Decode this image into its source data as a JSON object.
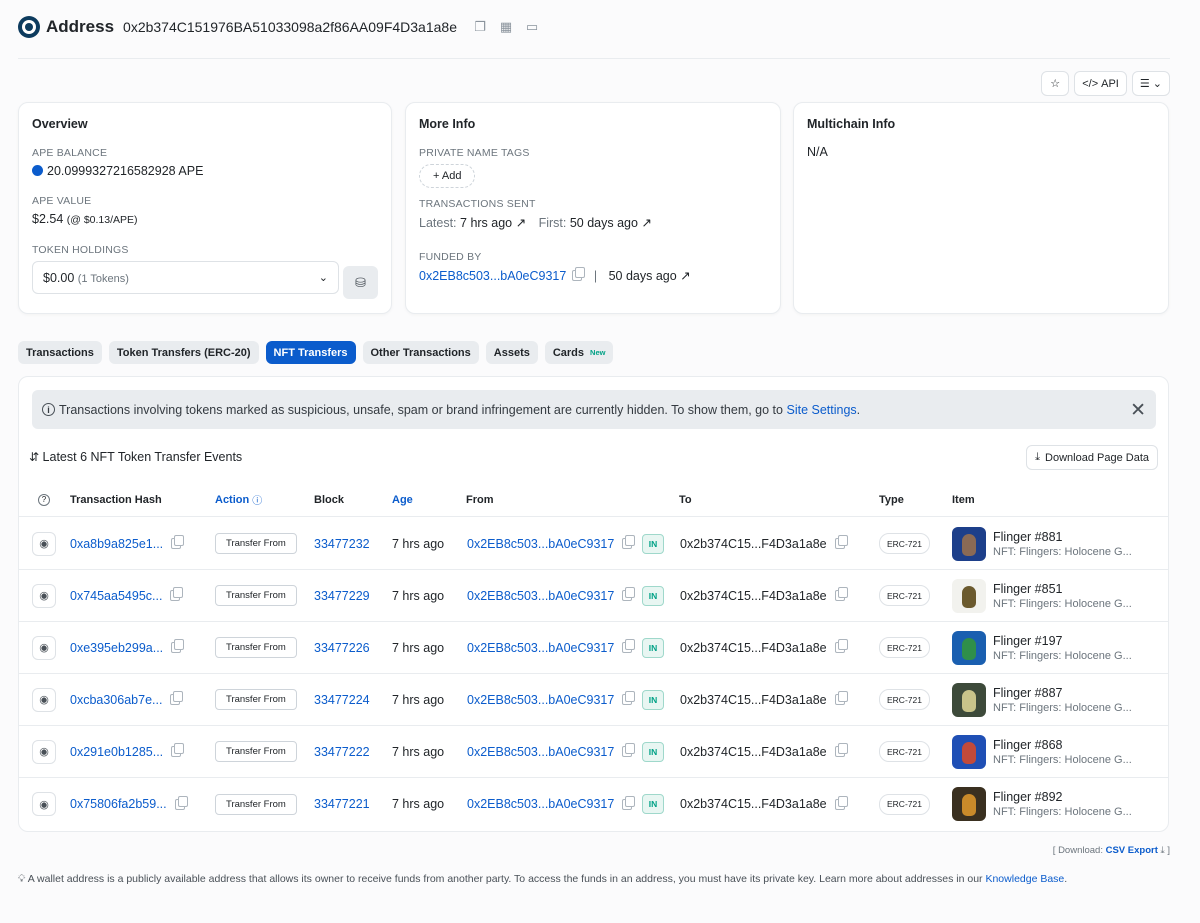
{
  "header": {
    "title": "Address",
    "address": "0x2b374C151976BA51033098a2f86AA09F4D3a1a8e"
  },
  "toolbar": {
    "api_label": "API"
  },
  "overview": {
    "title": "Overview",
    "balance_label": "APE BALANCE",
    "balance_value": "20.0999327216582928 APE",
    "value_label": "APE VALUE",
    "value_amount": "$2.54",
    "value_rate": "(@ $0.13/APE)",
    "holdings_label": "TOKEN HOLDINGS",
    "holdings_value": "$0.00",
    "holdings_count": "(1 Tokens)"
  },
  "more_info": {
    "title": "More Info",
    "tags_label": "PRIVATE NAME TAGS",
    "add_label": "+ Add",
    "tx_sent_label": "TRANSACTIONS SENT",
    "latest_label": "Latest:",
    "latest_value": "7 hrs ago",
    "first_label": "First:",
    "first_value": "50 days ago",
    "funded_label": "FUNDED BY",
    "funded_address": "0x2EB8c503...bA0eC9317",
    "funded_age": "50 days ago"
  },
  "multichain": {
    "title": "Multichain Info",
    "value": "N/A"
  },
  "tabs": [
    {
      "label": "Transactions"
    },
    {
      "label": "Token Transfers (ERC-20)"
    },
    {
      "label": "NFT Transfers"
    },
    {
      "label": "Other Transactions"
    },
    {
      "label": "Assets"
    },
    {
      "label": "Cards",
      "badge": "New"
    }
  ],
  "alert": {
    "text": "Transactions involving tokens marked as suspicious, unsafe, spam or brand infringement are currently hidden. To show them, go to",
    "link": "Site Settings",
    "end": "."
  },
  "events": {
    "title": "Latest 6 NFT Token Transfer Events",
    "download_label": "Download Page Data"
  },
  "table": {
    "headers": {
      "hash": "Transaction Hash",
      "action": "Action",
      "block": "Block",
      "age": "Age",
      "from": "From",
      "to": "To",
      "type": "Type",
      "item": "Item"
    },
    "rows": [
      {
        "hash": "0xa8b9a825e1...",
        "action": "Transfer From",
        "block": "33477232",
        "age": "7 hrs ago",
        "from": "0x2EB8c503...bA0eC9317",
        "dir": "IN",
        "to": "0x2b374C15...F4D3a1a8e",
        "type": "ERC-721",
        "item_name": "Flinger #881",
        "item_coll": "NFT: Flingers: Holocene G...",
        "thumb_bg": "#1d3f8a",
        "thumb_fg": "#8a6a55"
      },
      {
        "hash": "0x745aa5495c...",
        "action": "Transfer From",
        "block": "33477229",
        "age": "7 hrs ago",
        "from": "0x2EB8c503...bA0eC9317",
        "dir": "IN",
        "to": "0x2b374C15...F4D3a1a8e",
        "type": "ERC-721",
        "item_name": "Flinger #851",
        "item_coll": "NFT: Flingers: Holocene G...",
        "thumb_bg": "#f2f2ee",
        "thumb_fg": "#6b5a2e"
      },
      {
        "hash": "0xe395eb299a...",
        "action": "Transfer From",
        "block": "33477226",
        "age": "7 hrs ago",
        "from": "0x2EB8c503...bA0eC9317",
        "dir": "IN",
        "to": "0x2b374C15...F4D3a1a8e",
        "type": "ERC-721",
        "item_name": "Flinger #197",
        "item_coll": "NFT: Flingers: Holocene G...",
        "thumb_bg": "#1a5fb0",
        "thumb_fg": "#2f8f4a"
      },
      {
        "hash": "0xcba306ab7e...",
        "action": "Transfer From",
        "block": "33477224",
        "age": "7 hrs ago",
        "from": "0x2EB8c503...bA0eC9317",
        "dir": "IN",
        "to": "0x2b374C15...F4D3a1a8e",
        "type": "ERC-721",
        "item_name": "Flinger #887",
        "item_coll": "NFT: Flingers: Holocene G...",
        "thumb_bg": "#3d4a3a",
        "thumb_fg": "#c9c48a"
      },
      {
        "hash": "0x291e0b1285...",
        "action": "Transfer From",
        "block": "33477222",
        "age": "7 hrs ago",
        "from": "0x2EB8c503...bA0eC9317",
        "dir": "IN",
        "to": "0x2b374C15...F4D3a1a8e",
        "type": "ERC-721",
        "item_name": "Flinger #868",
        "item_coll": "NFT: Flingers: Holocene G...",
        "thumb_bg": "#1f4fb5",
        "thumb_fg": "#c24a3a"
      },
      {
        "hash": "0x75806fa2b59...",
        "action": "Transfer From",
        "block": "33477221",
        "age": "7 hrs ago",
        "from": "0x2EB8c503...bA0eC9317",
        "dir": "IN",
        "to": "0x2b374C15...F4D3a1a8e",
        "type": "ERC-721",
        "item_name": "Flinger #892",
        "item_coll": "NFT: Flingers: Holocene G...",
        "thumb_bg": "#3a3020",
        "thumb_fg": "#c98a2a"
      }
    ]
  },
  "csv": {
    "prefix": "[ Download:",
    "link": "CSV Export",
    "suffix": "]"
  },
  "footer": {
    "text": "A wallet address is a publicly available address that allows its owner to receive funds from another party. To access the funds in an address, you must have its private key. Learn more about addresses in our",
    "link": "Knowledge Base",
    "end": "."
  },
  "colors": {
    "accent": "#0b5ccc",
    "in_badge": "#00a186"
  }
}
